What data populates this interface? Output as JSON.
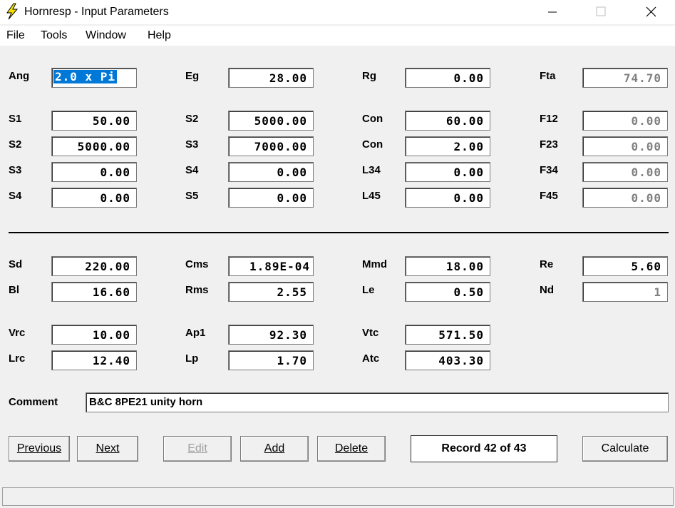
{
  "window": {
    "title": "Hornresp - Input Parameters"
  },
  "menu": [
    "File",
    "Tools",
    "Window",
    "Help"
  ],
  "fields": {
    "Ang": {
      "label": "Ang",
      "value": "2.0 x Pi"
    },
    "Eg": {
      "label": "Eg",
      "value": "28.00"
    },
    "Rg": {
      "label": "Rg",
      "value": "0.00"
    },
    "Fta": {
      "label": "Fta",
      "value": "74.70"
    },
    "S1": {
      "label": "S1",
      "value": "50.00"
    },
    "S2a": {
      "label": "S2",
      "value": "5000.00"
    },
    "Con1": {
      "label": "Con",
      "value": "60.00"
    },
    "F12": {
      "label": "F12",
      "value": "0.00"
    },
    "S2b": {
      "label": "S2",
      "value": "5000.00"
    },
    "S3a": {
      "label": "S3",
      "value": "7000.00"
    },
    "Con2": {
      "label": "Con",
      "value": "2.00"
    },
    "F23": {
      "label": "F23",
      "value": "0.00"
    },
    "S3b": {
      "label": "S3",
      "value": "0.00"
    },
    "S4a": {
      "label": "S4",
      "value": "0.00"
    },
    "L34": {
      "label": "L34",
      "value": "0.00"
    },
    "F34": {
      "label": "F34",
      "value": "0.00"
    },
    "S4b": {
      "label": "S4",
      "value": "0.00"
    },
    "S5": {
      "label": "S5",
      "value": "0.00"
    },
    "L45": {
      "label": "L45",
      "value": "0.00"
    },
    "F45": {
      "label": "F45",
      "value": "0.00"
    },
    "Sd": {
      "label": "Sd",
      "value": "220.00"
    },
    "Cms": {
      "label": "Cms",
      "value": "1.89E-04"
    },
    "Mmd": {
      "label": "Mmd",
      "value": "18.00"
    },
    "Re": {
      "label": "Re",
      "value": "5.60"
    },
    "Bl": {
      "label": "Bl",
      "value": "16.60"
    },
    "Rms": {
      "label": "Rms",
      "value": "2.55"
    },
    "Le": {
      "label": "Le",
      "value": "0.50"
    },
    "Nd": {
      "label": "Nd",
      "value": "1"
    },
    "Vrc": {
      "label": "Vrc",
      "value": "10.00"
    },
    "Ap1": {
      "label": "Ap1",
      "value": "92.30"
    },
    "Vtc": {
      "label": "Vtc",
      "value": "571.50"
    },
    "Lrc": {
      "label": "Lrc",
      "value": "12.40"
    },
    "Lp": {
      "label": "Lp",
      "value": "1.70"
    },
    "Atc": {
      "label": "Atc",
      "value": "403.30"
    }
  },
  "comment": {
    "label": "Comment",
    "value": "B&C 8PE21 unity horn"
  },
  "buttons": {
    "previous": "Previous",
    "next": "Next",
    "edit": "Edit",
    "add": "Add",
    "delete": "Delete",
    "calculate": "Calculate"
  },
  "record": "Record 42 of 43",
  "status": ""
}
